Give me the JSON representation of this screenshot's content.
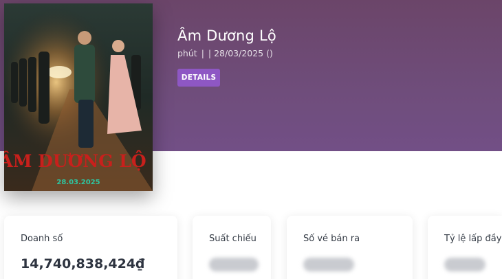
{
  "movie": {
    "title": "Âm Dương Lộ",
    "duration_unit": "phút",
    "separator": "|",
    "release": "| 28/03/2025 ()",
    "details_label": "DETAILS"
  },
  "poster": {
    "title_art": "ÂM DƯƠNG LỘ",
    "date": "28.03.2025"
  },
  "stats": [
    {
      "label": "Doanh số",
      "value": "14,740,838,424₫"
    },
    {
      "label": "Suất chiếu",
      "value": ""
    },
    {
      "label": "Số vé bán ra",
      "value": ""
    },
    {
      "label": "Tỷ lệ lấp đầy",
      "value": ""
    }
  ],
  "colors": {
    "hero_gradient_top": "#6b4569",
    "hero_gradient_bottom": "#724f86",
    "button": "#8e57c4",
    "poster_title": "#c8201c",
    "poster_date": "#2ec4a0"
  }
}
